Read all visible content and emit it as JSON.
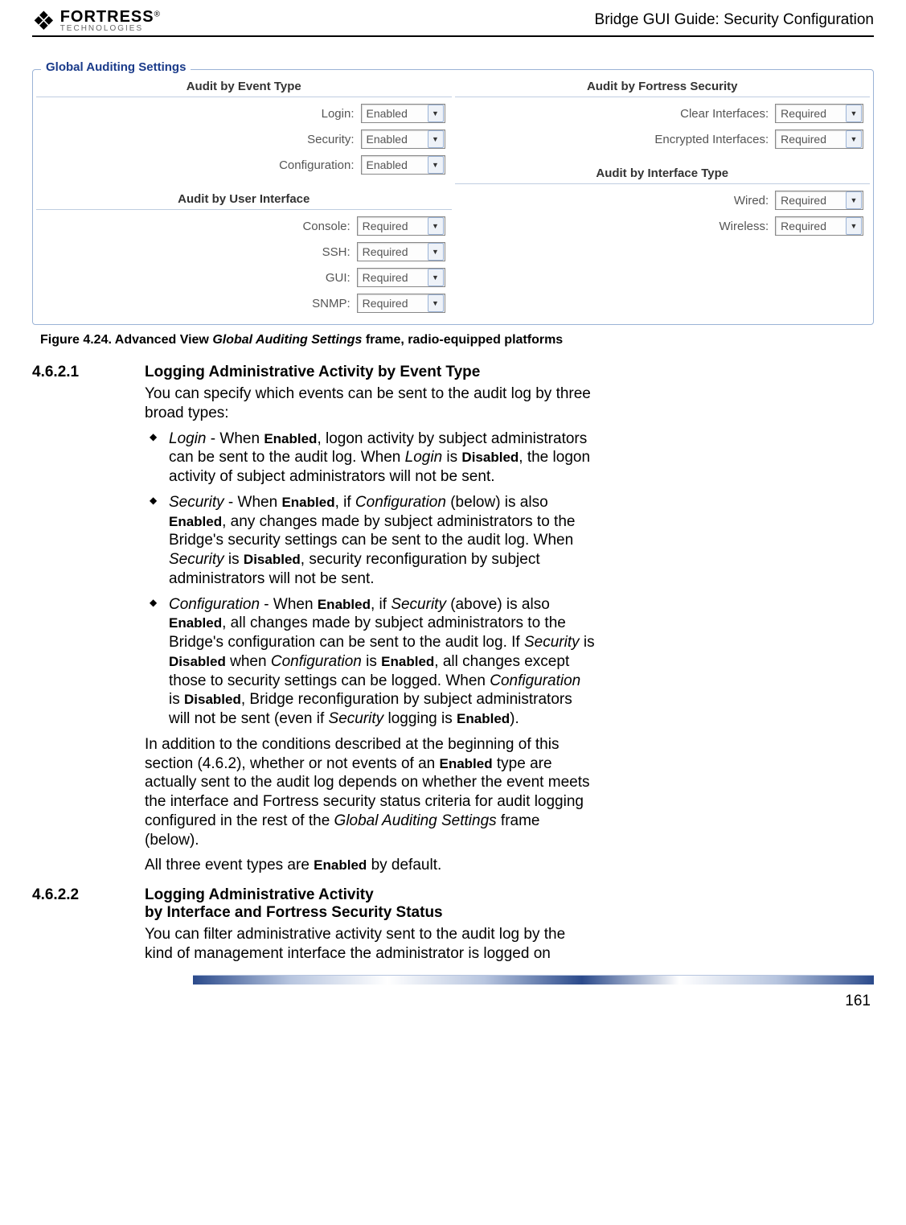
{
  "header": {
    "brand_main": "FORTRESS",
    "brand_reg": "®",
    "brand_sub": "TECHNOLOGIES",
    "doc_title": "Bridge GUI Guide: Security Configuration"
  },
  "fieldset": {
    "legend": "Global Auditing Settings",
    "left": {
      "sec1_title": "Audit by Event Type",
      "rows1": [
        {
          "label": "Login:",
          "value": "Enabled"
        },
        {
          "label": "Security:",
          "value": "Enabled"
        },
        {
          "label": "Configuration:",
          "value": "Enabled"
        }
      ],
      "sec2_title": "Audit by User Interface",
      "rows2": [
        {
          "label": "Console:",
          "value": "Required"
        },
        {
          "label": "SSH:",
          "value": "Required"
        },
        {
          "label": "GUI:",
          "value": "Required"
        },
        {
          "label": "SNMP:",
          "value": "Required"
        }
      ]
    },
    "right": {
      "sec1_title": "Audit by Fortress Security",
      "rows1": [
        {
          "label": "Clear Interfaces:",
          "value": "Required"
        },
        {
          "label": "Encrypted Interfaces:",
          "value": "Required"
        }
      ],
      "sec2_title": "Audit by Interface Type",
      "rows2": [
        {
          "label": "Wired:",
          "value": "Required"
        },
        {
          "label": "Wireless:",
          "value": "Required"
        }
      ]
    }
  },
  "figure": {
    "prefix": "Figure 4.24. Advanced View ",
    "em": "Global Auditing Settings",
    "suffix": " frame, radio-equipped platforms"
  },
  "s1": {
    "num": "4.6.2.1",
    "heading": "Logging Administrative Activity by Event Type",
    "intro": "You can specify which events can be sent to the audit log by three broad types:",
    "li1": {
      "a": "Login",
      "b": " - When ",
      "c": "Enabled",
      "d": ", logon activity by subject administrators can be sent to the audit log. When ",
      "e": "Login",
      "f": " is ",
      "g": "Disabled",
      "h": ", the logon activity of subject administrators will not be sent."
    },
    "li2": {
      "a": "Security",
      "b": " - When ",
      "c": "Enabled",
      "d": ", if ",
      "e": "Configuration",
      "f": " (below) is also ",
      "g": "Enabled",
      "h": ", any changes made by subject administrators to the Bridge's security settings can be sent to the audit log. When ",
      "i": "Security",
      "j": " is ",
      "k": "Disabled",
      "l": ", security reconfiguration by subject administrators will not be sent."
    },
    "li3": {
      "a": "Configuration",
      "b": " - When ",
      "c": "Enabled",
      "d": ", if ",
      "e": "Security",
      "f": " (above) is also ",
      "g": "Enabled",
      "h": ", all changes made by subject administrators to the Bridge's configuration can be sent to the audit log. If ",
      "i": "Security",
      "j": " is ",
      "k": "Disabled",
      "l": " when ",
      "m": "Configuration",
      "n": " is ",
      "o": "Enabled",
      "p": ", all changes except those to security settings can be logged. When ",
      "q": "Configuration",
      "r": " is ",
      "s": "Disabled",
      "t": ", Bridge reconfiguration by subject administrators will not be sent (even if ",
      "u": "Security",
      "v": " logging is ",
      "w": "Enabled",
      "x": ")."
    },
    "p2": {
      "a": "In addition to the conditions described at the beginning of this section (4.6.2), whether or not events of an ",
      "b": "Enabled",
      "c": " type are actually sent to the audit log depends on whether the event meets the interface and Fortress security status criteria for audit logging configured in the rest of the ",
      "d": "Global Auditing Settings",
      "e": " frame (below)."
    },
    "p3": {
      "a": "All three event types are ",
      "b": "Enabled",
      "c": " by default."
    }
  },
  "s2": {
    "num": "4.6.2.2",
    "h1": "Logging Administrative Activity",
    "h2": "by Interface and Fortress Security Status",
    "intro": "You can filter administrative activity sent to the audit log by the kind of management interface the administrator is logged on"
  },
  "page_number": "161"
}
